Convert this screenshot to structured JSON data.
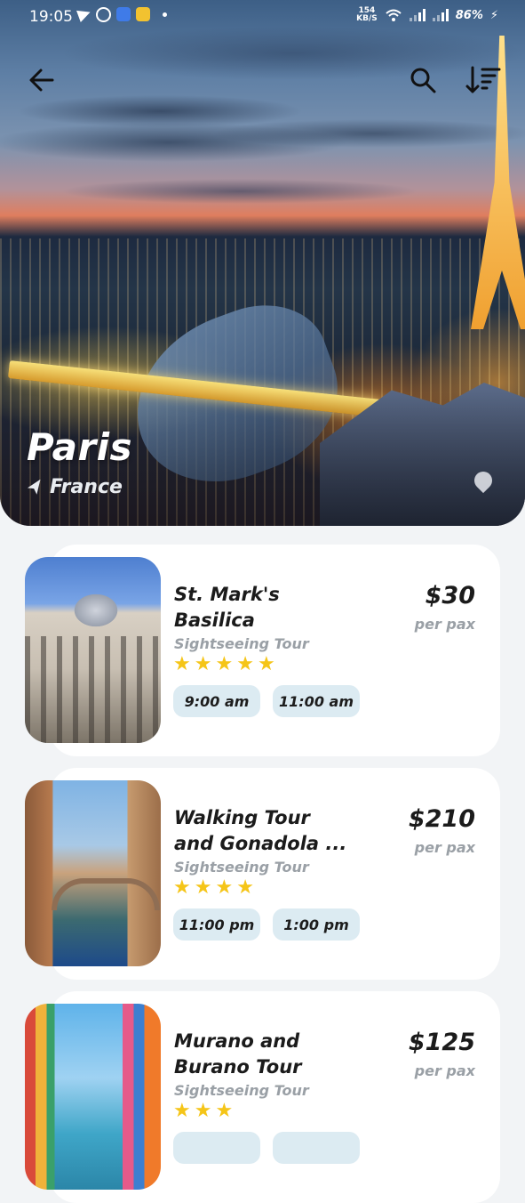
{
  "status_bar": {
    "time": "19:05",
    "net_speed": "154",
    "net_unit": "KB/S",
    "battery": "86%"
  },
  "hero": {
    "city": "Paris",
    "country": "France"
  },
  "icons": {
    "back": "arrow-left-icon",
    "search": "search-icon",
    "sort": "sort-descending-icon",
    "location": "navigation-arrow-icon"
  },
  "colors": {
    "chip_bg": "#dcebf2",
    "star": "#f5c518",
    "muted_text": "#9aa0a6",
    "card_bg": "#ffffff",
    "page_bg": "#f2f4f6"
  },
  "tours": [
    {
      "title": "St. Mark's\nBasilica",
      "type": "Sightseeing Tour",
      "rating": 5,
      "times": [
        "9:00 am",
        "11:00 am"
      ],
      "price": "$30",
      "per": "per pax"
    },
    {
      "title": "Walking Tour\nand Gonadola ...",
      "type": "Sightseeing Tour",
      "rating": 4,
      "times": [
        "11:00 pm",
        "1:00 pm"
      ],
      "price": "$210",
      "per": "per pax"
    },
    {
      "title": "Murano and\nBurano Tour",
      "type": "Sightseeing Tour",
      "rating": 3,
      "times": [
        "",
        ""
      ],
      "price": "$125",
      "per": "per pax"
    }
  ]
}
